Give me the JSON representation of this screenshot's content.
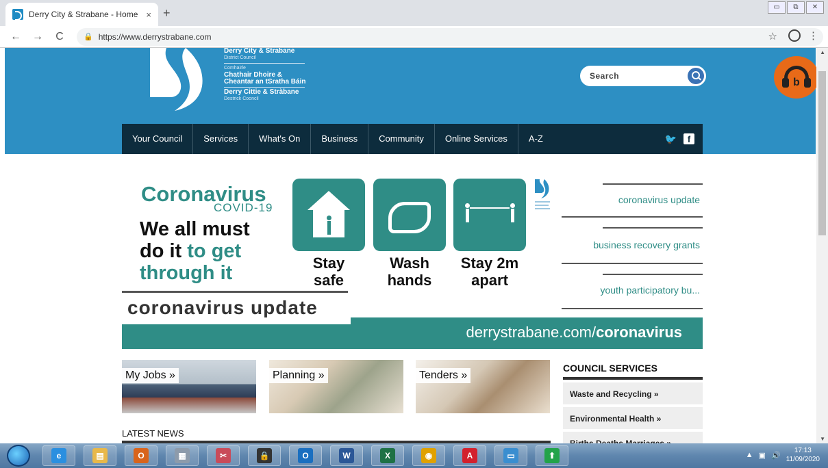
{
  "browser": {
    "tab_title": "Derry City & Strabane - Home",
    "tab_close": "×",
    "new_tab": "+",
    "url": "https://www.derrystrabane.com",
    "back": "←",
    "forward": "→",
    "reload": "C",
    "lock": "🔒",
    "star": "☆",
    "menu": "⋮",
    "win_controls": [
      "▭",
      "⧉",
      "✕"
    ]
  },
  "header": {
    "logo": {
      "line1": "Derry City & Strabane",
      "line1_sub": "District Council",
      "line2_sub": "Comhairle",
      "line2a": "Chathair Dhoire &",
      "line2b": "Cheantar an tSratha Báin",
      "line3": "Derry Cittie & Stràbane",
      "line3_sub": "Destrick Cooncil"
    },
    "search_label": "Search",
    "reader_letter": "b"
  },
  "nav": {
    "items": [
      "Your Council",
      "Services",
      "What's On",
      "Business",
      "Community",
      "Online Services",
      "A-Z"
    ],
    "twitter": "🐦",
    "facebook": "f"
  },
  "banner": {
    "title": "Coronavirus",
    "subtitle": "COVID-19",
    "line1": "We all must",
    "line2a": "do it ",
    "line2b": "to get",
    "line3": "through it",
    "tiles": [
      {
        "cap1": "Stay",
        "cap2": "safe"
      },
      {
        "cap1": "Wash",
        "cap2": "hands"
      },
      {
        "cap1": "Stay 2m",
        "cap2": "apart"
      }
    ],
    "band_title": "coronavirus update",
    "strip_prefix": "derrystrabane.com/",
    "strip_bold": "coronavirus"
  },
  "side_links": [
    "coronavirus update",
    "business recovery grants",
    "youth participatory bu..."
  ],
  "photo_tiles": [
    "My Jobs »",
    "Planning »",
    "Tenders »"
  ],
  "services": {
    "title": "COUNCIL SERVICES",
    "items": [
      "Waste and Recycling »",
      "Environmental Health »",
      "Births Deaths Marriages »"
    ]
  },
  "news": {
    "title": "LATEST NEWS"
  },
  "taskbar": {
    "time": "17:13",
    "date": "11/09/2020",
    "tray_arrow": "▲",
    "volume": "🔊",
    "apps": [
      {
        "name": "internet-explorer",
        "glyph": "e",
        "color": "#2a8fe0"
      },
      {
        "name": "file-explorer",
        "glyph": "▤",
        "color": "#e8b84a"
      },
      {
        "name": "outlook-calendar",
        "glyph": "O",
        "color": "#d8641c"
      },
      {
        "name": "calculator",
        "glyph": "▦",
        "color": "#8d9bab"
      },
      {
        "name": "snipping-tool",
        "glyph": "✂",
        "color": "#c94b5a"
      },
      {
        "name": "lock-app",
        "glyph": "🔒",
        "color": "#333333"
      },
      {
        "name": "outlook",
        "glyph": "O",
        "color": "#1a6fc0"
      },
      {
        "name": "word",
        "glyph": "W",
        "color": "#2b5797"
      },
      {
        "name": "excel",
        "glyph": "X",
        "color": "#1e7145"
      },
      {
        "name": "chrome",
        "glyph": "◉",
        "color": "#e0a100"
      },
      {
        "name": "acrobat",
        "glyph": "A",
        "color": "#d3212d"
      },
      {
        "name": "photos",
        "glyph": "▭",
        "color": "#3a8ed0"
      },
      {
        "name": "update-arrow",
        "glyph": "⬆",
        "color": "#22a34a"
      }
    ]
  }
}
